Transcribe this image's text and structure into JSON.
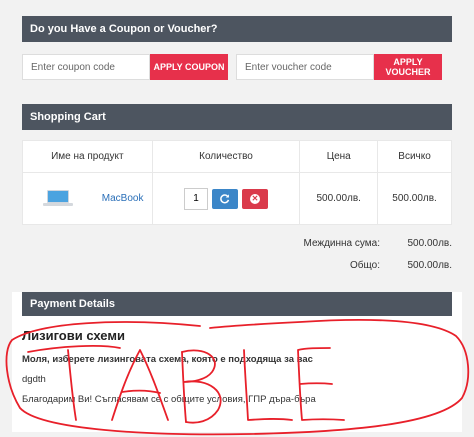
{
  "coupon": {
    "header": "Do you Have a Coupon or Voucher?",
    "coupon_placeholder": "Enter coupon code",
    "apply_coupon_label": "APPLY COUPON",
    "voucher_placeholder": "Enter voucher code",
    "apply_voucher_label": "APPLY VOUCHER"
  },
  "cart": {
    "header": "Shopping Cart",
    "columns": [
      "Име на продукт",
      "Количество",
      "Цена",
      "Всичко"
    ],
    "items": [
      {
        "name": "MacBook",
        "quantity": "1",
        "price": "500.00лв.",
        "total": "500.00лв.",
        "icon": "laptop-icon"
      }
    ],
    "subtotal_label": "Междинна сума:",
    "subtotal_value": "500.00лв.",
    "total_label": "Общо:",
    "total_value": "500.00лв."
  },
  "payment": {
    "header": "Payment Details",
    "title": "Лизигови схеми",
    "instruction": "Моля, изберете лизинговата схема, която е подходяща за вас",
    "note": "dgdth",
    "agreement": "Благодарим Ви! Съгласявам се с общите условия, ГПР дъра-бъра"
  },
  "annotation": {
    "text": "TABLE",
    "color": "#e8202a"
  },
  "colors": {
    "accent_red": "#e7304b",
    "header_gray": "#4d5560",
    "link_blue": "#2a6fb8"
  }
}
